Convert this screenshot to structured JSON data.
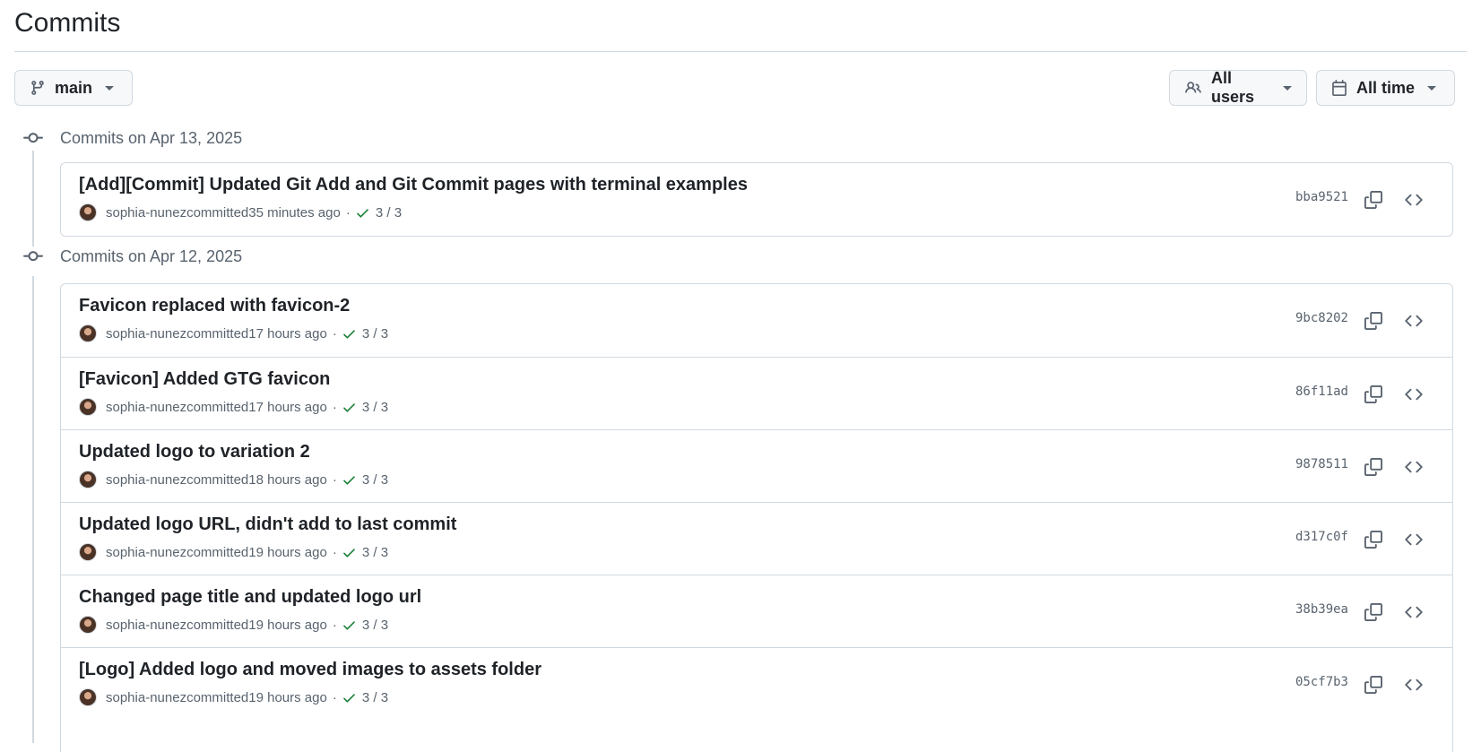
{
  "page": {
    "title": "Commits"
  },
  "filters": {
    "branch": {
      "label": "main",
      "icon": "git-branch-icon"
    },
    "users": {
      "label": "All users",
      "icon": "people-icon"
    },
    "time": {
      "label": "All time",
      "icon": "calendar-icon"
    }
  },
  "groups": [
    {
      "label": "Commits on Apr 13, 2025",
      "commits": [
        {
          "message": "[Add][Commit] Updated Git Add and Git Commit pages with terminal examples",
          "author": "sophia-nunez",
          "action": "committed",
          "time": "35 minutes ago",
          "checks": "3 / 3",
          "sha": "bba9521"
        }
      ]
    },
    {
      "label": "Commits on Apr 12, 2025",
      "commits": [
        {
          "message": "Favicon replaced with favicon-2",
          "author": "sophia-nunez",
          "action": "committed",
          "time": "17 hours ago",
          "checks": "3 / 3",
          "sha": "9bc8202"
        },
        {
          "message": "[Favicon] Added GTG favicon",
          "author": "sophia-nunez",
          "action": "committed",
          "time": "17 hours ago",
          "checks": "3 / 3",
          "sha": "86f11ad"
        },
        {
          "message": "Updated logo to variation 2",
          "author": "sophia-nunez",
          "action": "committed",
          "time": "18 hours ago",
          "checks": "3 / 3",
          "sha": "9878511"
        },
        {
          "message": "Updated logo URL, didn't add to last commit",
          "author": "sophia-nunez",
          "action": "committed",
          "time": "19 hours ago",
          "checks": "3 / 3",
          "sha": "d317c0f"
        },
        {
          "message": "Changed page title and updated logo url",
          "author": "sophia-nunez",
          "action": "committed",
          "time": "19 hours ago",
          "checks": "3 / 3",
          "sha": "38b39ea"
        },
        {
          "message": "[Logo] Added logo and moved images to assets folder",
          "author": "sophia-nunez",
          "action": "committed",
          "time": "19 hours ago",
          "checks": "3 / 3",
          "sha": "05cf7b3"
        }
      ]
    }
  ],
  "colors": {
    "text": "#1f2328",
    "muted": "#59636e",
    "border": "#d1d9e0",
    "success": "#1a7f37",
    "button_bg": "#f6f8fa"
  }
}
